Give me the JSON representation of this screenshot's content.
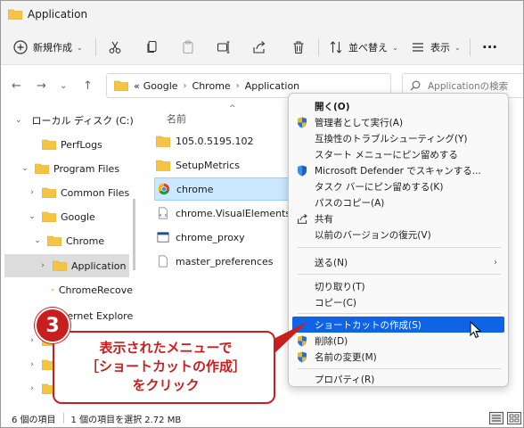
{
  "window": {
    "title": "Application"
  },
  "toolbar": {
    "new_label": "新規作成",
    "sort_label": "並べ替え",
    "view_label": "表示",
    "more_label": "..."
  },
  "address": {
    "prefix": "«",
    "crumbs": [
      "Google",
      "Chrome",
      "Application"
    ],
    "search_placeholder": "Applicationの検索"
  },
  "tree": {
    "items": [
      {
        "label": "ローカル ディスク (C:)"
      },
      {
        "label": "PerfLogs"
      },
      {
        "label": "Program Files"
      },
      {
        "label": "Common Files"
      },
      {
        "label": "Google"
      },
      {
        "label": "Chrome"
      },
      {
        "label": "Application"
      },
      {
        "label": "ChromeRecove"
      },
      {
        "label": "ternet Explorer"
      }
    ]
  },
  "files": {
    "column_name": "名前",
    "items": [
      {
        "label": "105.0.5195.102",
        "icon": "folder-icon"
      },
      {
        "label": "SetupMetrics",
        "icon": "folder-icon"
      },
      {
        "label": "chrome",
        "icon": "chrome-icon"
      },
      {
        "label": "chrome.VisualElementsManit",
        "icon": "xml-file-icon"
      },
      {
        "label": "chrome_proxy",
        "icon": "exe-icon"
      },
      {
        "label": "master_preferences",
        "icon": "file-icon"
      }
    ]
  },
  "context_menu": {
    "items": [
      {
        "label": "開く(O)"
      },
      {
        "label": "管理者として実行(A)"
      },
      {
        "label": "互換性のトラブルシューティング(Y)"
      },
      {
        "label": "スタート メニューにピン留めする"
      },
      {
        "label": "Microsoft Defender でスキャンする..."
      },
      {
        "label": "タスク バーにピン留めする(K)"
      },
      {
        "label": "パスのコピー(A)"
      },
      {
        "label": "共有"
      },
      {
        "label": "以前のバージョンの復元(V)"
      },
      {
        "label": "送る(N)"
      },
      {
        "label": "切り取り(T)"
      },
      {
        "label": "コピー(C)"
      },
      {
        "label": "ショートカットの作成(S)"
      },
      {
        "label": "削除(D)"
      },
      {
        "label": "名前の変更(M)"
      },
      {
        "label": "プロパティ(R)"
      }
    ]
  },
  "status": {
    "count": "6 個の項目",
    "selection": "1 個の項目を選択  2.72 MB"
  },
  "callout": {
    "step": "3",
    "line1": "表示されたメニューで",
    "line2": "［ショートカットの作成］",
    "line3": "をクリック"
  },
  "colors": {
    "accent_red": "#c91e1e",
    "menu_highlight": "#0f63e6",
    "selection_blue": "#cce8ff",
    "folder_yellow": "#f4c542"
  }
}
